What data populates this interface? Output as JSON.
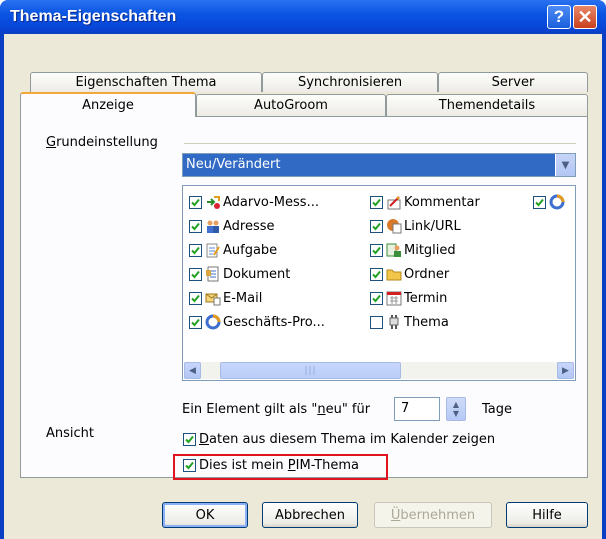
{
  "window": {
    "title": "Thema-Eigenschaften"
  },
  "titlebar_buttons": {
    "help": "?",
    "close": "✕"
  },
  "tabs": {
    "row1": [
      "Eigenschaften Thema",
      "Synchronisieren",
      "Server"
    ],
    "row2": [
      "Anzeige",
      "AutoGroom",
      "Themendetails"
    ],
    "active": "Anzeige"
  },
  "grundeinstellung": {
    "label_pre": "",
    "label_u": "G",
    "label_post": "rundeinstellung",
    "selected": "Neu/Verändert"
  },
  "items": [
    {
      "label": "Adarvo-Mess...",
      "checked": true,
      "icon": "move-items-icon"
    },
    {
      "label": "Adresse",
      "checked": true,
      "icon": "people-icon"
    },
    {
      "label": "Aufgabe",
      "checked": true,
      "icon": "task-icon"
    },
    {
      "label": "Dokument",
      "checked": true,
      "icon": "document-icon"
    },
    {
      "label": "E-Mail",
      "checked": true,
      "icon": "email-icon"
    },
    {
      "label": "Geschäfts-Pro...",
      "checked": true,
      "icon": "process-icon"
    },
    {
      "label": "Kommentar",
      "checked": true,
      "icon": "comment-icon"
    },
    {
      "label": "Link/URL",
      "checked": true,
      "icon": "link-icon"
    },
    {
      "label": "Mitglied",
      "checked": true,
      "icon": "member-icon"
    },
    {
      "label": "Ordner",
      "checked": true,
      "icon": "folder-icon"
    },
    {
      "label": "Termin",
      "checked": true,
      "icon": "calendar-icon"
    },
    {
      "label": "Thema",
      "checked": false,
      "icon": "topic-icon"
    }
  ],
  "ansicht": {
    "label": "Ansicht",
    "neu_pre": "Ein Element gilt als \"",
    "neu_u": "n",
    "neu_post": "eu\" für",
    "days_value": "7",
    "days_unit": "Tage",
    "kalender_pre": "",
    "kalender_u": "D",
    "kalender_post": "aten aus diesem Thema im Kalender zeigen",
    "kalender_checked": true,
    "pim_pre": "Dies ist mein ",
    "pim_u": "P",
    "pim_post": "IM-Thema",
    "pim_checked": true
  },
  "buttons": {
    "ok": "OK",
    "cancel": "Abbrechen",
    "apply_u": "Ü",
    "apply_rest": "bernehmen",
    "help": "Hilfe"
  },
  "colors": {
    "highlight_border": "#e0141e",
    "selection": "#316ac5",
    "title_bar": "#0a55e3"
  }
}
